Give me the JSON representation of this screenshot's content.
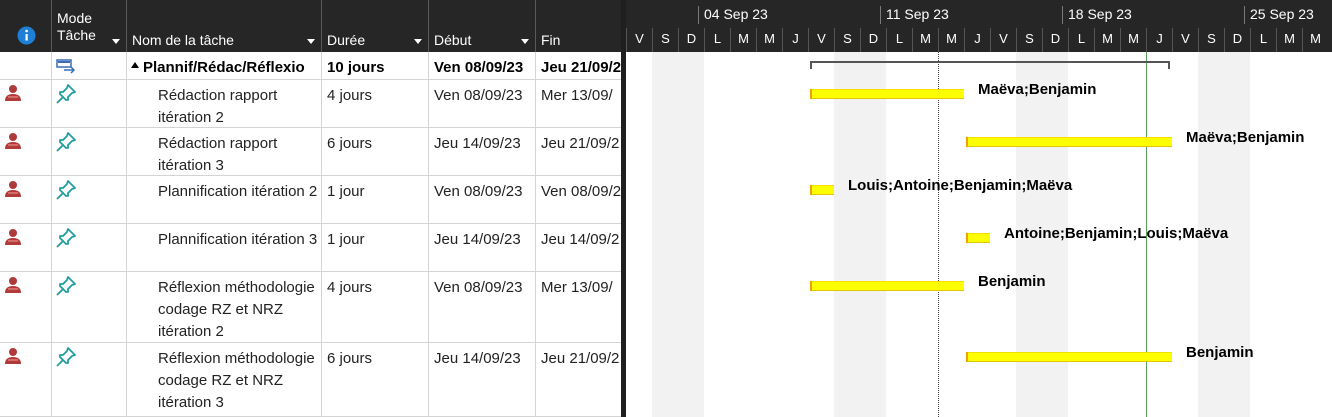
{
  "header": {
    "info_col": "",
    "mode_col": [
      "Mode",
      "Tâche"
    ],
    "name_col": "Nom de la tâche",
    "duration_col": "Durée",
    "start_col": "Début",
    "end_col": "Fin"
  },
  "rows": [
    {
      "name": "Plannif/Rédac/Réflexio",
      "duration": "10 jours",
      "start": "Ven 08/09/23",
      "end": "Jeu 21/09/2",
      "summary": true
    },
    {
      "name": "Rédaction rapport itération 2",
      "duration": "4 jours",
      "start": "Ven 08/09/23",
      "end": "Mer 13/09/"
    },
    {
      "name": "Rédaction rapport itération 3",
      "duration": "6 jours",
      "start": "Jeu 14/09/23",
      "end": "Jeu 21/09/2"
    },
    {
      "name": "Plannification itération 2",
      "duration": "1 jour",
      "start": "Ven 08/09/23",
      "end": "Ven 08/09/2"
    },
    {
      "name": "Plannification itération 3",
      "duration": "1 jour",
      "start": "Jeu 14/09/23",
      "end": "Jeu 14/09/2"
    },
    {
      "name": "Réflexion méthodologie codage RZ et NRZ itération 2",
      "duration": "4 jours",
      "start": "Ven 08/09/23",
      "end": "Mer 13/09/"
    },
    {
      "name": "Réflexion méthodologie codage RZ et NRZ itération 3",
      "duration": "6 jours",
      "start": "Jeu 14/09/23",
      "end": "Jeu 21/09/2"
    }
  ],
  "timescale": {
    "weeks": [
      "04 Sep 23",
      "11 Sep 23",
      "18 Sep 23",
      "25 Sep 23"
    ],
    "days": [
      "V",
      "S",
      "D",
      "L",
      "M",
      "M",
      "J",
      "V",
      "S",
      "D",
      "L",
      "M",
      "M",
      "J",
      "V",
      "S",
      "D",
      "L",
      "M",
      "M",
      "J",
      "V",
      "S",
      "D",
      "L",
      "M",
      "M"
    ]
  },
  "gantt": {
    "bars": [
      {
        "start": "08/09/23",
        "end": "13/09/23",
        "resources": "Maëva;Benjamin"
      },
      {
        "start": "14/09/23",
        "end": "21/09/23",
        "resources": "Maëva;Benjamin"
      },
      {
        "start": "08/09/23",
        "end": "08/09/23",
        "resources": "Louis;Antoine;Benjamin;Maëva"
      },
      {
        "start": "14/09/23",
        "end": "14/09/23",
        "resources": "Antoine;Benjamin;Louis;Maëva"
      },
      {
        "start": "08/09/23",
        "end": "13/09/23",
        "resources": "Benjamin"
      },
      {
        "start": "14/09/23",
        "end": "21/09/23",
        "resources": "Benjamin"
      }
    ],
    "colors": {
      "bar": "#ffff00",
      "header_bg": "#262626",
      "resource_icon": "#b03a3a",
      "pin_icon": "#1f9e9e",
      "info_icon": "#1e7fd6",
      "status_line": "#5aa05a"
    }
  }
}
